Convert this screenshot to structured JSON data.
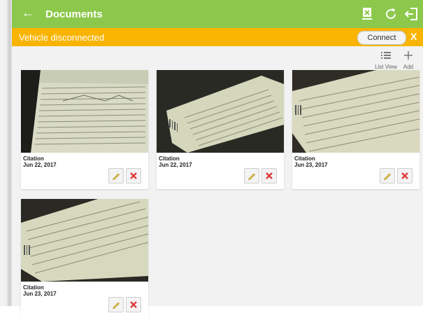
{
  "appbar": {
    "back_icon": "arrow-left-icon",
    "title": "Documents",
    "icons": [
      "device-download-icon",
      "refresh-icon",
      "logout-icon"
    ],
    "color": "#8cc84b"
  },
  "banner": {
    "message": "Vehicle disconnected",
    "connect_label": "Connect",
    "close_label": "X",
    "color": "#f8b400"
  },
  "toolbar": {
    "list_view_label": "List View",
    "add_label": "Add"
  },
  "documents": [
    {
      "name": "Citation",
      "date": "Jun 22, 2017"
    },
    {
      "name": "Citation",
      "date": "Jun 22, 2017"
    },
    {
      "name": "Citation",
      "date": "Jun 23, 2017"
    },
    {
      "name": "Citation",
      "date": "Jun 23, 2017"
    }
  ]
}
